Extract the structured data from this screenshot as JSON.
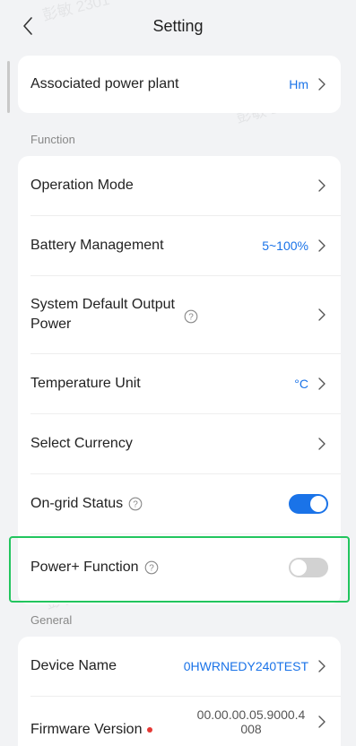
{
  "header": {
    "title": "Setting"
  },
  "watermark": "彭敏 2301",
  "plant": {
    "label": "Associated power plant",
    "value": "Hm"
  },
  "sections": {
    "function": "Function",
    "general": "General"
  },
  "function_items": {
    "operation_mode": {
      "label": "Operation Mode"
    },
    "battery": {
      "label": "Battery Management",
      "value": "5~100%"
    },
    "output_power": {
      "label_line1": "System Default Output",
      "label_line2": "Power"
    },
    "temp_unit": {
      "label": "Temperature Unit",
      "value": "°C"
    },
    "currency": {
      "label": "Select Currency"
    },
    "on_grid": {
      "label": "On-grid Status",
      "enabled": true
    },
    "power_plus": {
      "label": "Power+ Function",
      "enabled": false
    }
  },
  "general_items": {
    "device_name": {
      "label": "Device Name",
      "value": "0HWRNEDY240TEST"
    },
    "firmware": {
      "label": "Firmware Version",
      "value_line1": "00.00.00.05.9000.4",
      "value_line2": "008"
    }
  },
  "colors": {
    "accent": "#1a73e8",
    "highlight": "#22c55e",
    "alert": "#e53935"
  }
}
